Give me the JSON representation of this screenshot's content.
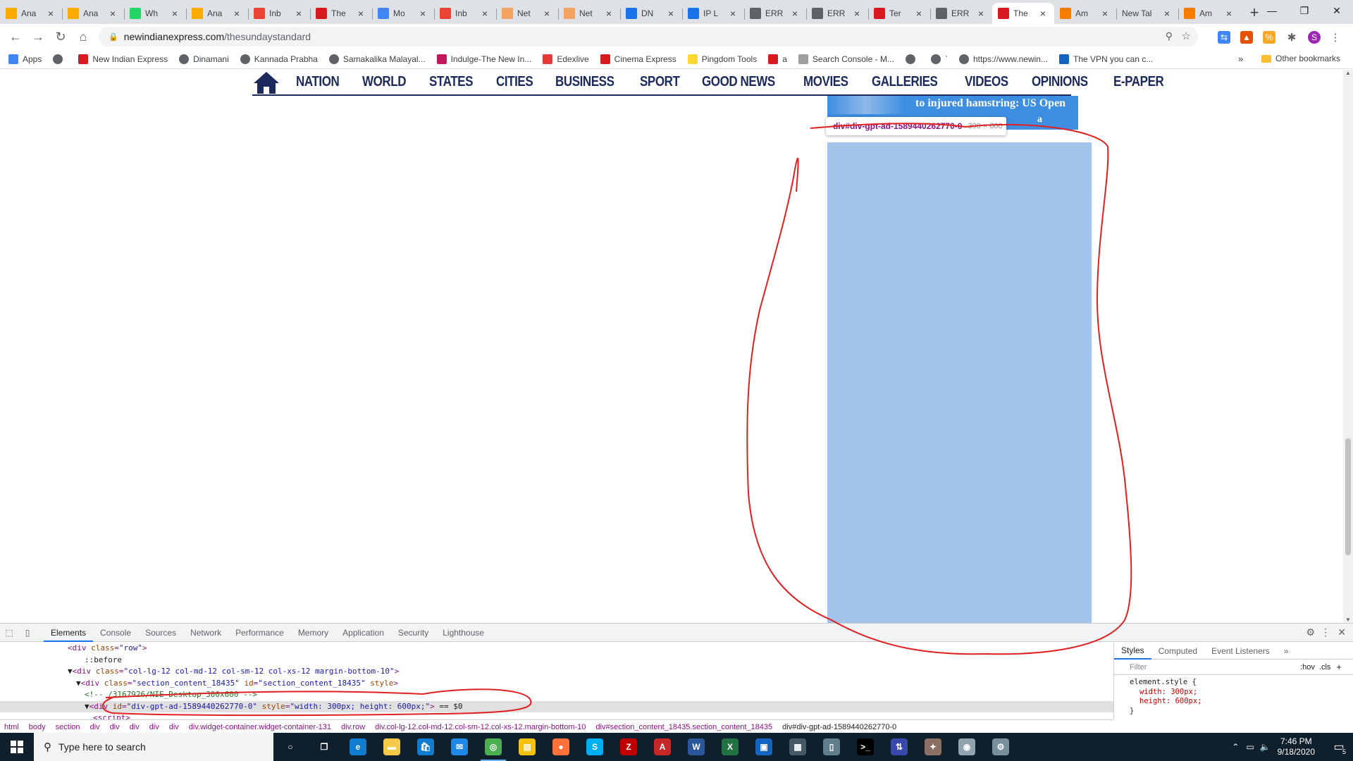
{
  "browser": {
    "tabs": [
      {
        "title": "Ana",
        "icon": "analytics-icon",
        "color": "#f9ab00"
      },
      {
        "title": "Ana",
        "icon": "analytics-icon",
        "color": "#f9ab00"
      },
      {
        "title": "Wh",
        "icon": "whatsapp-icon",
        "color": "#25d366"
      },
      {
        "title": "Ana",
        "icon": "analytics-icon",
        "color": "#f9ab00"
      },
      {
        "title": "Inb",
        "icon": "gmail-icon",
        "color": "#ea4335"
      },
      {
        "title": "The",
        "icon": "tnie-icon",
        "color": "#d71920"
      },
      {
        "title": "Mo",
        "icon": "mobile-icon",
        "color": "#4285f4"
      },
      {
        "title": "Inb",
        "icon": "gmail-icon",
        "color": "#ea4335"
      },
      {
        "title": "Net",
        "icon": "netlify-icon",
        "color": "#f4a261"
      },
      {
        "title": "Net",
        "icon": "netlify-icon",
        "color": "#f4a261"
      },
      {
        "title": "DN",
        "icon": "location-icon",
        "color": "#1a73e8"
      },
      {
        "title": "IP L",
        "icon": "location-icon",
        "color": "#1a73e8"
      },
      {
        "title": "ERR",
        "icon": "globe-icon",
        "color": "#5f6368"
      },
      {
        "title": "ERR",
        "icon": "globe-icon",
        "color": "#5f6368"
      },
      {
        "title": "Ter",
        "icon": "tnie-icon",
        "color": "#d71920"
      },
      {
        "title": "ERR",
        "icon": "globe-icon",
        "color": "#5f6368"
      },
      {
        "title": "The",
        "icon": "tnie-icon",
        "color": "#d71920"
      },
      {
        "title": "Am",
        "icon": "cube-icon",
        "color": "#f57c00"
      },
      {
        "title": "New Tal",
        "icon": "",
        "color": ""
      },
      {
        "title": "Am",
        "icon": "cube-icon",
        "color": "#f57c00"
      }
    ],
    "active_tab_index": 16,
    "url_host": "newindianexpress.com",
    "url_path": "/thesundaystandard",
    "profile_initial": "S"
  },
  "bookmarks": [
    {
      "label": "Apps",
      "icon": "apps-icon",
      "color": "#4285f4"
    },
    {
      "label": "",
      "icon": "globe-icon",
      "color": "#5f6368"
    },
    {
      "label": "New Indian Express",
      "icon": "tnie-icon",
      "color": "#d71920"
    },
    {
      "label": "Dinamani",
      "icon": "globe-icon",
      "color": "#5f6368"
    },
    {
      "label": "Kannada Prabha",
      "icon": "globe-icon",
      "color": "#5f6368"
    },
    {
      "label": "Samakalika Malayal...",
      "icon": "globe-icon",
      "color": "#5f6368"
    },
    {
      "label": "Indulge-The New In...",
      "icon": "indulge-icon",
      "color": "#c2185b"
    },
    {
      "label": "Edexlive",
      "icon": "edexlive-icon",
      "color": "#e53935"
    },
    {
      "label": "Cinema Express",
      "icon": "ce-icon",
      "color": "#d71920"
    },
    {
      "label": "Pingdom Tools",
      "icon": "pingdom-icon",
      "color": "#fdd835"
    },
    {
      "label": "a",
      "icon": "tnie-icon",
      "color": "#d71920"
    },
    {
      "label": "Search Console - M...",
      "icon": "search-console-icon",
      "color": "#9e9e9e"
    },
    {
      "label": "",
      "icon": "globe-icon",
      "color": "#5f6368"
    },
    {
      "label": "`",
      "icon": "globe-icon",
      "color": "#5f6368"
    },
    {
      "label": "https://www.newin...",
      "icon": "globe-icon",
      "color": "#5f6368"
    },
    {
      "label": "The VPN you can c...",
      "icon": "vpn-icon",
      "color": "#1565c0"
    }
  ],
  "other_bookmarks": "Other bookmarks",
  "site": {
    "nav": [
      "NATION",
      "WORLD",
      "STATES",
      "CITIES",
      "BUSINESS",
      "SPORT",
      "GOOD NEWS",
      "MOVIES",
      "GALLERIES",
      "VIDEOS",
      "OPINIONS",
      "E-PAPER"
    ],
    "story_headline": "to injured hamstring: US Open",
    "story_more": "a",
    "tooltip_id": "div#div-gpt-ad-1589440262770-0",
    "tooltip_size": "300 × 600"
  },
  "devtools": {
    "tabs": [
      "Elements",
      "Console",
      "Sources",
      "Network",
      "Performance",
      "Memory",
      "Application",
      "Security",
      "Lighthouse"
    ],
    "active_tab": "Elements",
    "dom_lines": [
      {
        "indent": 8,
        "parts": [
          [
            "tag",
            "<div "
          ],
          [
            "attr",
            "class"
          ],
          [
            "tag",
            "="
          ],
          [
            "val",
            "\"row\""
          ],
          [
            "tag",
            ">"
          ]
        ]
      },
      {
        "indent": 10,
        "parts": [
          [
            "plain",
            "::before"
          ]
        ]
      },
      {
        "indent": 8,
        "parts": [
          [
            "plain",
            "▼"
          ],
          [
            "tag",
            "<div "
          ],
          [
            "attr",
            "class"
          ],
          [
            "tag",
            "="
          ],
          [
            "val",
            "\"col-lg-12 col-md-12 col-sm-12 col-xs-12 margin-bottom-10\""
          ],
          [
            "tag",
            ">"
          ]
        ]
      },
      {
        "indent": 9,
        "parts": [
          [
            "plain",
            "▼"
          ],
          [
            "tag",
            "<div "
          ],
          [
            "attr",
            "class"
          ],
          [
            "tag",
            "="
          ],
          [
            "val",
            "\"section_content_18435\""
          ],
          [
            "attr",
            " id"
          ],
          [
            "tag",
            "="
          ],
          [
            "val",
            "\"section_content_18435\""
          ],
          [
            "attr",
            " style"
          ],
          [
            "tag",
            ">"
          ]
        ]
      },
      {
        "indent": 10,
        "parts": [
          [
            "cmt",
            "<!-- /3167926/NIE_Desktop_300x600 -->"
          ]
        ]
      },
      {
        "indent": 10,
        "parts": [
          [
            "plain",
            "▼"
          ],
          [
            "tag",
            "<div "
          ],
          [
            "attr",
            "id"
          ],
          [
            "tag",
            "="
          ],
          [
            "val",
            "\"div-gpt-ad-1589440262770-0\""
          ],
          [
            "attr",
            " style"
          ],
          [
            "tag",
            "="
          ],
          [
            "val",
            "\"width: 300px; height: 600px;\""
          ],
          [
            "tag",
            ">"
          ],
          [
            "plain",
            " == $0"
          ]
        ],
        "selected": true
      },
      {
        "indent": 11,
        "parts": [
          [
            "tag",
            "<script>"
          ]
        ]
      }
    ],
    "styles_tabs": [
      "Styles",
      "Computed",
      "Event Listeners",
      "»"
    ],
    "filter_placeholder": "Filter",
    "filter_hov": ":hov",
    "filter_cls": ".cls",
    "rule_selector": "element.style {",
    "rule_props": [
      "width: 300px;",
      "height: 600px;"
    ],
    "rule_close": "}",
    "breadcrumbs": [
      "html",
      "body",
      "section",
      "div",
      "div",
      "div",
      "div",
      "div",
      "div.widget-container.widget-container-131",
      "div.row",
      "div.col-lg-12.col-md-12.col-sm-12.col-xs-12.margin-bottom-10",
      "div#section_content_18435.section_content_18435",
      "div#div-gpt-ad-1589440262770-0"
    ]
  },
  "taskbar": {
    "search_placeholder": "Type here to search",
    "apps": [
      {
        "icon": "cortana-icon",
        "color": "#101f2c",
        "glyph": "○"
      },
      {
        "icon": "task-view-icon",
        "color": "#101f2c",
        "glyph": "❐"
      },
      {
        "icon": "edge-icon",
        "color": "#0f7bd1",
        "glyph": "e"
      },
      {
        "icon": "file-explorer-icon",
        "color": "#f7c948",
        "glyph": "▬"
      },
      {
        "icon": "store-icon",
        "color": "#0f7bd1",
        "glyph": "🛍"
      },
      {
        "icon": "mail-icon",
        "color": "#1e88e5",
        "glyph": "✉"
      },
      {
        "icon": "chrome-icon",
        "color": "#4caf50",
        "glyph": "◎",
        "active": true
      },
      {
        "icon": "sticky-icon",
        "color": "#f4c20d",
        "glyph": "▤"
      },
      {
        "icon": "firefox-icon",
        "color": "#ff7139",
        "glyph": "●"
      },
      {
        "icon": "skype-icon",
        "color": "#00aff0",
        "glyph": "S"
      },
      {
        "icon": "filezilla-icon",
        "color": "#bf0000",
        "glyph": "Z"
      },
      {
        "icon": "pdf-icon",
        "color": "#c62828",
        "glyph": "A"
      },
      {
        "icon": "word-icon",
        "color": "#2b579a",
        "glyph": "W"
      },
      {
        "icon": "excel-icon",
        "color": "#217346",
        "glyph": "X"
      },
      {
        "icon": "remote-desktop-icon",
        "color": "#1565c0",
        "glyph": "▣"
      },
      {
        "icon": "photos-icon",
        "color": "#455a64",
        "glyph": "▦"
      },
      {
        "icon": "notepad-icon",
        "color": "#607d8b",
        "glyph": "▯"
      },
      {
        "icon": "terminal-icon",
        "color": "#000000",
        "glyph": ">_"
      },
      {
        "icon": "network-icon",
        "color": "#3949ab",
        "glyph": "⇅"
      },
      {
        "icon": "puzzle-icon",
        "color": "#8d6e63",
        "glyph": "✦"
      },
      {
        "icon": "game-icon",
        "color": "#90a4ae",
        "glyph": "◉"
      },
      {
        "icon": "settings-app-icon",
        "color": "#78909c",
        "glyph": "⚙"
      }
    ],
    "time": "7:46 PM",
    "date": "9/18/2020",
    "notification_count": "5"
  },
  "colors": {
    "ad_highlight": "#a1c4e8",
    "annotation": "#e02020",
    "nav_text": "#1b2a5a"
  }
}
